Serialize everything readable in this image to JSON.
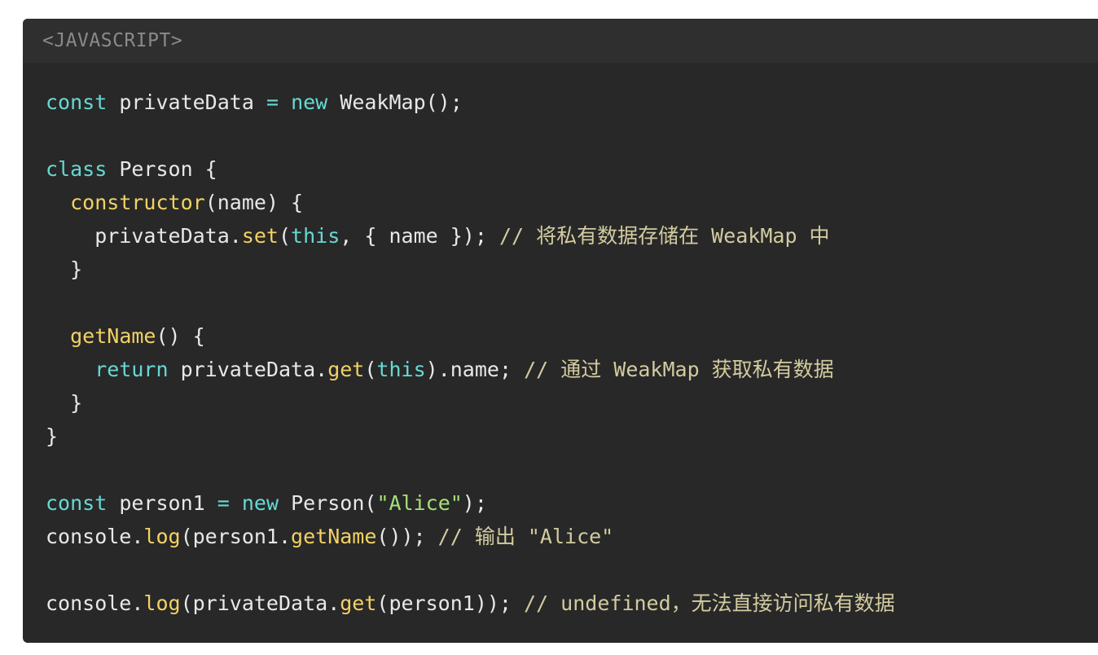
{
  "header": {
    "language_label": "<JAVASCRIPT>"
  },
  "colors": {
    "background": "#282828",
    "header_background": "#2f2f2f",
    "keyword": "#66d9d3",
    "function": "#f2d264",
    "string": "#a6e07a",
    "comment": "#d2cba0",
    "plain": "#e8e8e8"
  },
  "code": {
    "lines": [
      [
        {
          "t": "kw",
          "v": "const"
        },
        {
          "t": "pl",
          "v": " privateData "
        },
        {
          "t": "kw",
          "v": "="
        },
        {
          "t": "pl",
          "v": " "
        },
        {
          "t": "kw",
          "v": "new"
        },
        {
          "t": "pl",
          "v": " WeakMap();"
        }
      ],
      [],
      [
        {
          "t": "kw",
          "v": "class"
        },
        {
          "t": "pl",
          "v": " Person {"
        }
      ],
      [
        {
          "t": "pl",
          "v": "  "
        },
        {
          "t": "fn",
          "v": "constructor"
        },
        {
          "t": "pl",
          "v": "(name) {"
        }
      ],
      [
        {
          "t": "pl",
          "v": "    privateData."
        },
        {
          "t": "fn",
          "v": "set"
        },
        {
          "t": "pl",
          "v": "("
        },
        {
          "t": "kw",
          "v": "this"
        },
        {
          "t": "pl",
          "v": ", { name }); "
        },
        {
          "t": "cm",
          "v": "// 将私有数据存储在 WeakMap 中"
        }
      ],
      [
        {
          "t": "pl",
          "v": "  }"
        }
      ],
      [],
      [
        {
          "t": "pl",
          "v": "  "
        },
        {
          "t": "fn",
          "v": "getName"
        },
        {
          "t": "pl",
          "v": "() {"
        }
      ],
      [
        {
          "t": "pl",
          "v": "    "
        },
        {
          "t": "kw",
          "v": "return"
        },
        {
          "t": "pl",
          "v": " privateData."
        },
        {
          "t": "fn",
          "v": "get"
        },
        {
          "t": "pl",
          "v": "("
        },
        {
          "t": "kw",
          "v": "this"
        },
        {
          "t": "pl",
          "v": ").name; "
        },
        {
          "t": "cm",
          "v": "// 通过 WeakMap 获取私有数据"
        }
      ],
      [
        {
          "t": "pl",
          "v": "  }"
        }
      ],
      [
        {
          "t": "pl",
          "v": "}"
        }
      ],
      [],
      [
        {
          "t": "kw",
          "v": "const"
        },
        {
          "t": "pl",
          "v": " person1 "
        },
        {
          "t": "kw",
          "v": "="
        },
        {
          "t": "pl",
          "v": " "
        },
        {
          "t": "kw",
          "v": "new"
        },
        {
          "t": "pl",
          "v": " Person("
        },
        {
          "t": "str",
          "v": "\"Alice\""
        },
        {
          "t": "pl",
          "v": ");"
        }
      ],
      [
        {
          "t": "pl",
          "v": "console."
        },
        {
          "t": "fn",
          "v": "log"
        },
        {
          "t": "pl",
          "v": "(person1."
        },
        {
          "t": "fn",
          "v": "getName"
        },
        {
          "t": "pl",
          "v": "()); "
        },
        {
          "t": "cm",
          "v": "// 输出 \"Alice\""
        }
      ],
      [],
      [
        {
          "t": "pl",
          "v": "console."
        },
        {
          "t": "fn",
          "v": "log"
        },
        {
          "t": "pl",
          "v": "(privateData."
        },
        {
          "t": "fn",
          "v": "get"
        },
        {
          "t": "pl",
          "v": "(person1)); "
        },
        {
          "t": "cm",
          "v": "// undefined，无法直接访问私有数据"
        }
      ]
    ]
  }
}
